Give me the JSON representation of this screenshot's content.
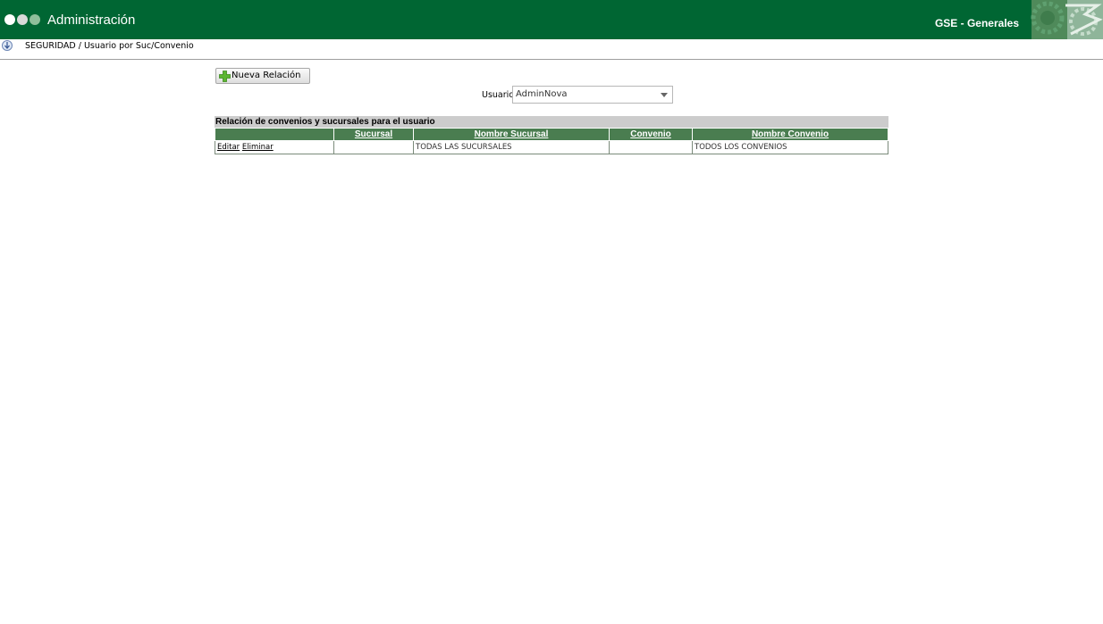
{
  "header": {
    "app_title": "Administración",
    "system_name": "GSE - Generales",
    "brand_color": "#006633",
    "window_dots": [
      "#ffffff",
      "#d9d9d9",
      "#8fbf9b"
    ]
  },
  "breadcrumb": {
    "icon": "info-arrow-icon",
    "text": "SEGURIDAD / Usuario por Suc/Convenio"
  },
  "toolbar": {
    "new_relation_label": "Nueva Relación",
    "new_relation_icon": "plus-icon"
  },
  "filter": {
    "user_label": "Usuario",
    "user_value": "AdminNova"
  },
  "grid": {
    "caption": "Relación de convenios y sucursales para el usuario",
    "header_color": "#4a7d50",
    "columns": [
      "",
      "Sucursal",
      "Nombre Sucursal",
      "Convenio",
      "Nombre Convenio"
    ],
    "rows": [
      {
        "edit_label": "Editar",
        "delete_label": "Eliminar",
        "sucursal": "",
        "nombre_sucursal": "TODAS LAS SUCURSALES",
        "convenio": "",
        "nombre_convenio": "TODOS LOS CONVENIOS"
      }
    ]
  }
}
